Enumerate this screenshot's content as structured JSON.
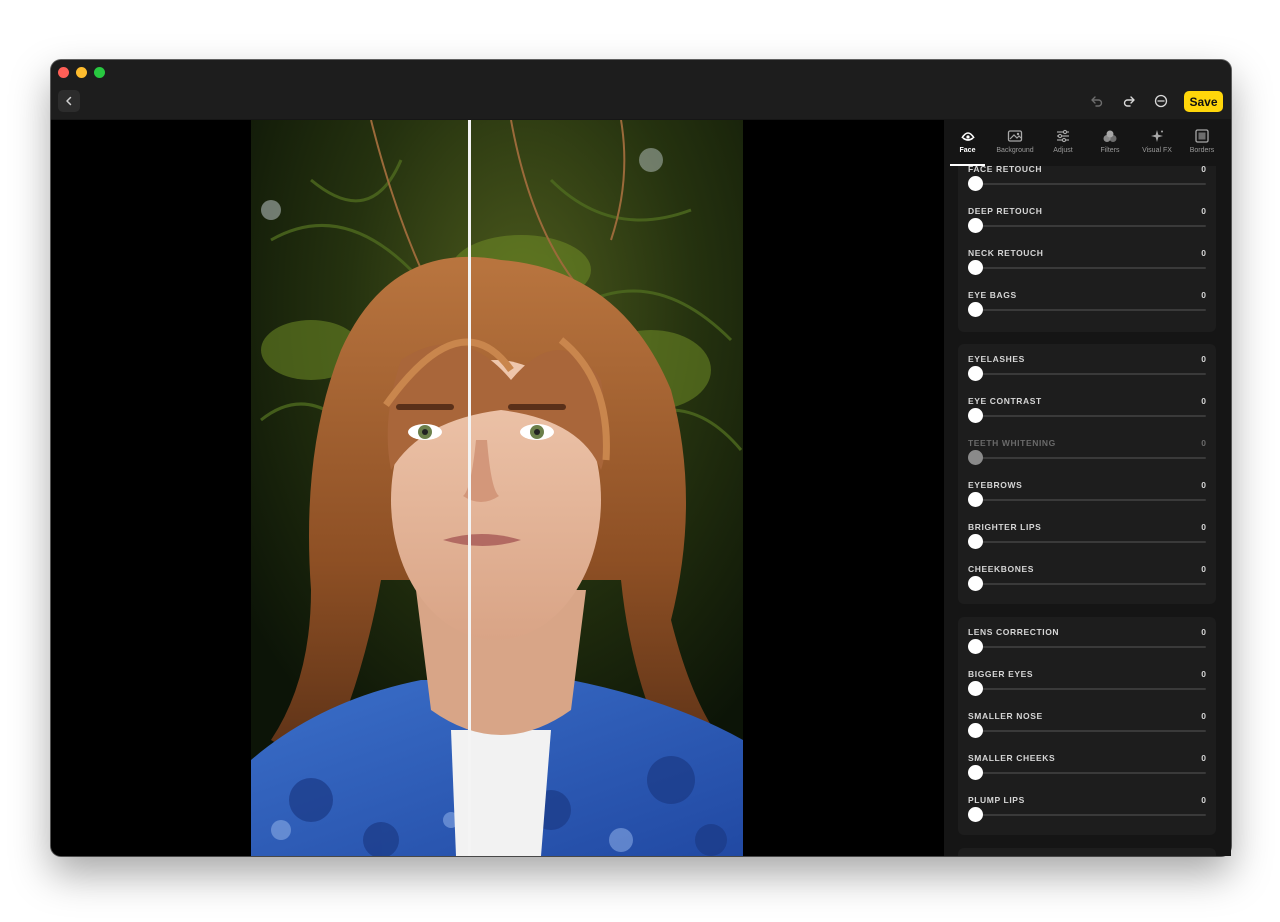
{
  "colors": {
    "accent": "#ffd60a",
    "traffic_close": "#ff5f57",
    "traffic_minimize": "#febc2e",
    "traffic_zoom": "#28c840"
  },
  "toolbar": {
    "back_icon": "chevron-left-icon",
    "undo_icon": "undo-icon",
    "redo_icon": "redo-icon",
    "compare_icon": "compare-icon",
    "save_label": "Save"
  },
  "tabs": [
    {
      "label": "Face",
      "icon": "face-icon",
      "active": true
    },
    {
      "label": "Background",
      "icon": "image-icon",
      "active": false
    },
    {
      "label": "Adjust",
      "icon": "sliders-icon",
      "active": false
    },
    {
      "label": "Filters",
      "icon": "filters-icon",
      "active": false
    },
    {
      "label": "Visual FX",
      "icon": "sparkle-icon",
      "active": false
    },
    {
      "label": "Borders",
      "icon": "border-icon",
      "active": false
    }
  ],
  "groups": [
    {
      "sliders": [
        {
          "label": "FACE RETOUCH",
          "value": "0"
        },
        {
          "label": "DEEP RETOUCH",
          "value": "0"
        },
        {
          "label": "NECK RETOUCH",
          "value": "0"
        },
        {
          "label": "EYE BAGS",
          "value": "0"
        }
      ]
    },
    {
      "sliders": [
        {
          "label": "EYELASHES",
          "value": "0"
        },
        {
          "label": "EYE CONTRAST",
          "value": "0"
        },
        {
          "label": "TEETH WHITENING",
          "value": "0",
          "disabled": true
        },
        {
          "label": "EYEBROWS",
          "value": "0"
        },
        {
          "label": "BRIGHTER LIPS",
          "value": "0"
        },
        {
          "label": "CHEEKBONES",
          "value": "0"
        }
      ]
    },
    {
      "sliders": [
        {
          "label": "LENS CORRECTION",
          "value": "0"
        },
        {
          "label": "BIGGER EYES",
          "value": "0"
        },
        {
          "label": "SMALLER NOSE",
          "value": "0"
        },
        {
          "label": "SMALLER CHEEKS",
          "value": "0"
        },
        {
          "label": "PLUMP LIPS",
          "value": "0"
        }
      ]
    }
  ]
}
